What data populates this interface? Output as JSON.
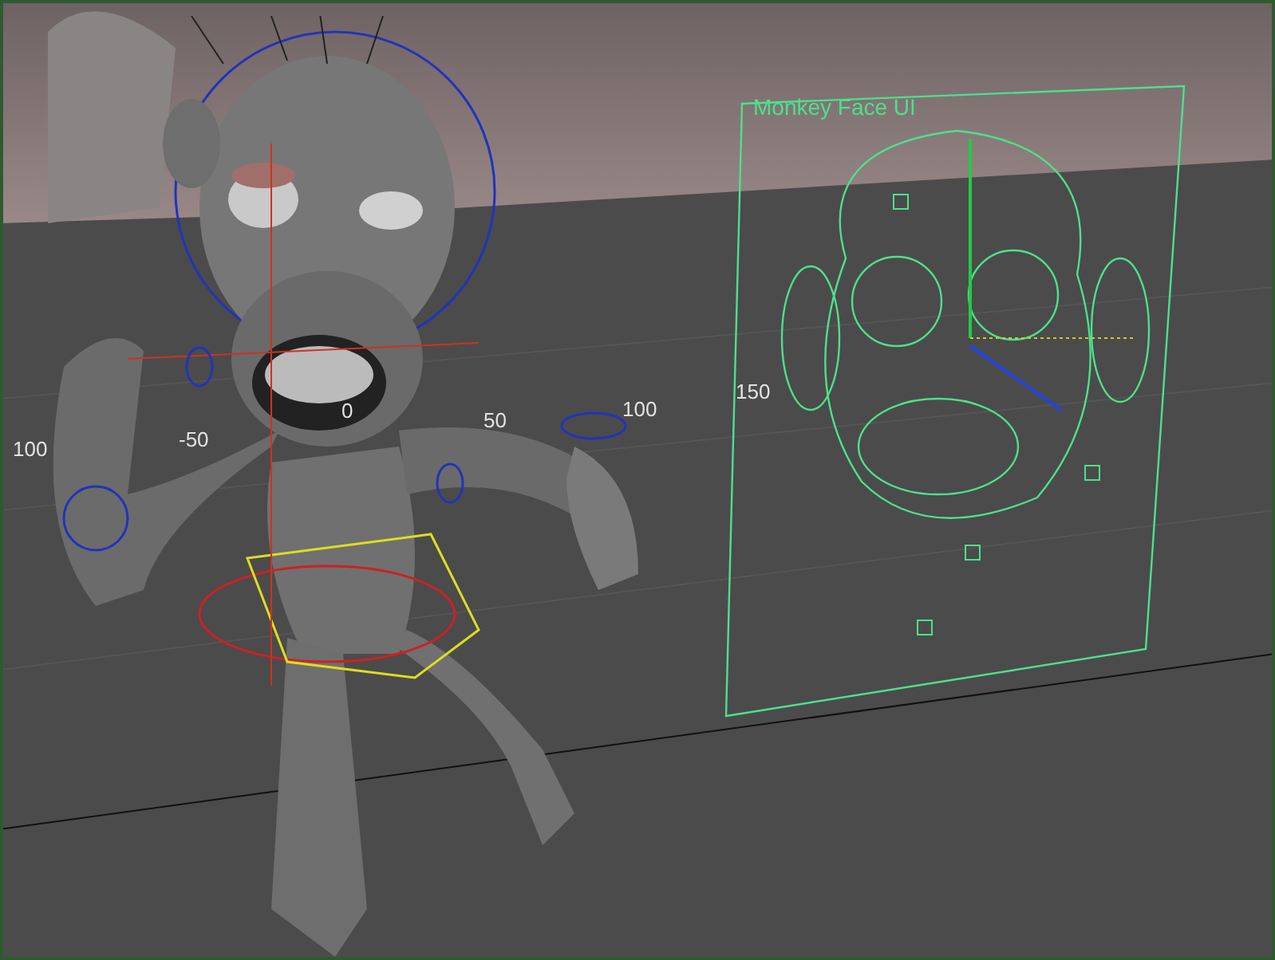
{
  "viewport": {
    "grid_labels": [
      "100",
      "-50",
      "0",
      "50",
      "100",
      "150"
    ]
  },
  "face_ui": {
    "title": "Monkey Face UI"
  }
}
